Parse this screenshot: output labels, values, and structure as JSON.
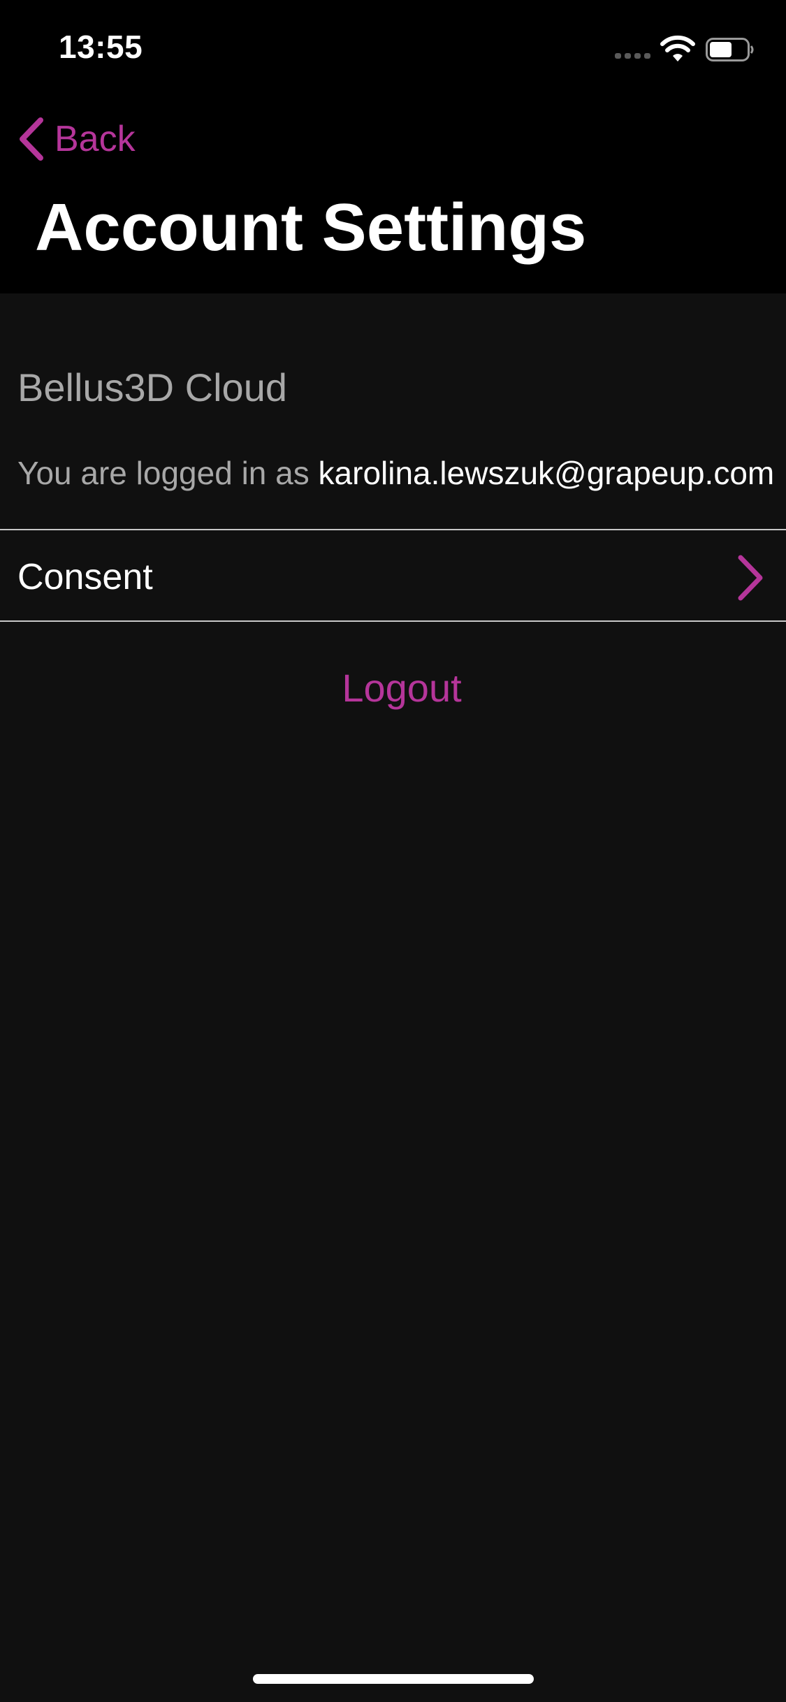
{
  "status_bar": {
    "time": "13:55",
    "signal_icon": "cellular-signal-icon",
    "wifi_icon": "wifi-icon",
    "battery_icon": "battery-icon",
    "battery_level": 0.6
  },
  "nav": {
    "back_label": "Back",
    "back_icon": "chevron-left-icon",
    "title": "Account Settings"
  },
  "account": {
    "section_title": "Bellus3D Cloud",
    "logged_in_prefix": "You are logged in as",
    "email": "karolina.lewszuk@grapeup.com"
  },
  "consent_row": {
    "label": "Consent",
    "icon": "chevron-right-icon"
  },
  "logout_label": "Logout",
  "colors": {
    "accent": "#b5359a",
    "header_background": "#000000",
    "page_background": "#101010",
    "secondary_text": "#a8a8a8"
  }
}
